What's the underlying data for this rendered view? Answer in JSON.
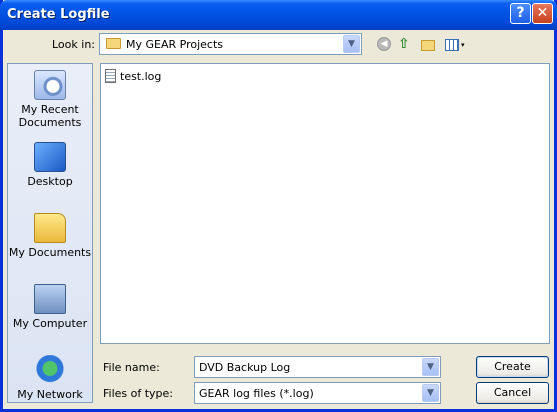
{
  "window": {
    "title": "Create Logfile",
    "help_glyph": "?",
    "close_glyph": "✕"
  },
  "lookin": {
    "label": "Look in:",
    "value": "My GEAR Projects",
    "arrow": "▼"
  },
  "toolbar": {
    "back_glyph": "◀",
    "up_glyph": "⇧",
    "views_dd": "▾"
  },
  "places": [
    {
      "label": "My Recent Documents",
      "icon": "recent-documents-icon"
    },
    {
      "label": "Desktop",
      "icon": "desktop-icon"
    },
    {
      "label": "My Documents",
      "icon": "my-documents-icon"
    },
    {
      "label": "My Computer",
      "icon": "my-computer-icon"
    },
    {
      "label": "My Network",
      "icon": "my-network-icon"
    }
  ],
  "files": [
    {
      "name": "test.log",
      "icon": "log-file-icon"
    }
  ],
  "filename": {
    "label": "File name:",
    "value": "DVD Backup Log",
    "arrow": "▼"
  },
  "filetype": {
    "label": "Files of type:",
    "value": "GEAR log files (*.log)",
    "arrow": "▼"
  },
  "buttons": {
    "create": "Create",
    "cancel": "Cancel"
  },
  "colors": {
    "titlebar": "#0055e5",
    "dialog_bg": "#ece9d8",
    "border": "#7f9db9"
  }
}
